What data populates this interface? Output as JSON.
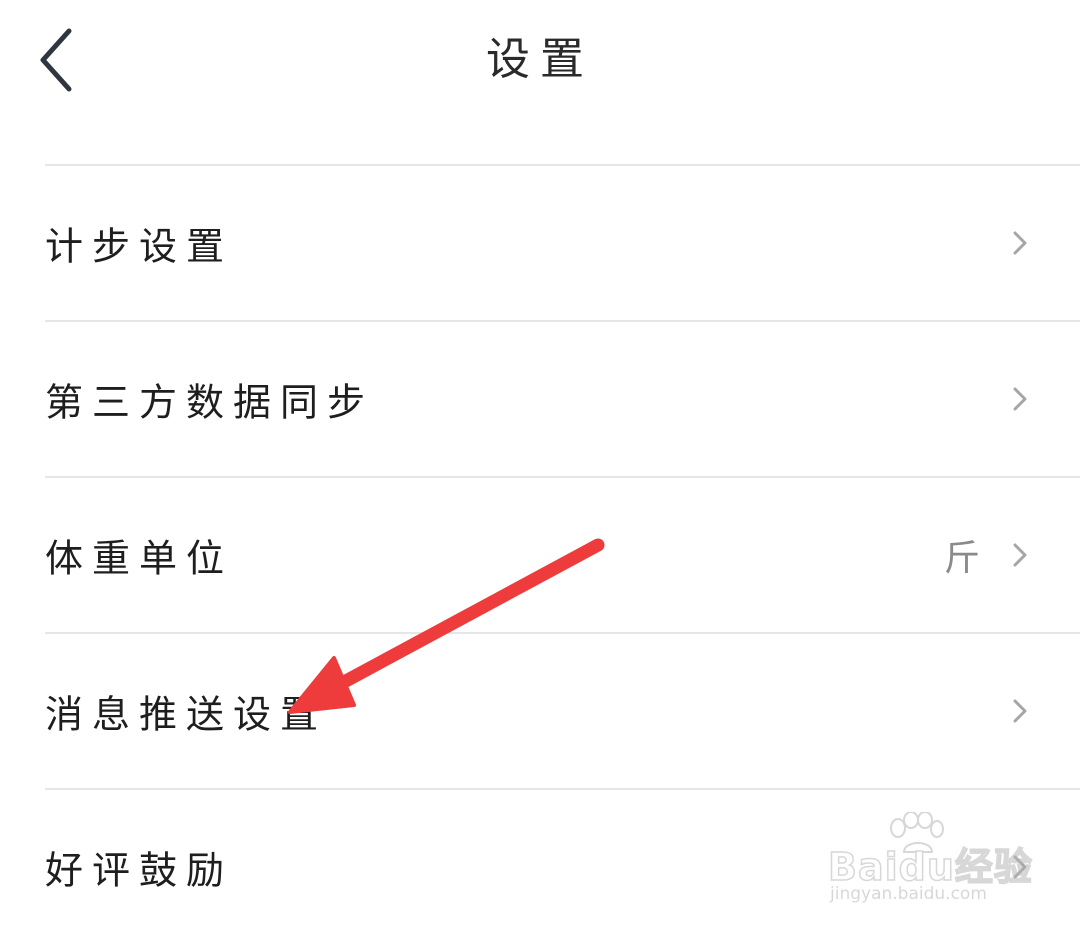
{
  "header": {
    "title": "设置"
  },
  "settings": {
    "items": [
      {
        "label": "计步设置",
        "value": ""
      },
      {
        "label": "第三方数据同步",
        "value": ""
      },
      {
        "label": "体重单位",
        "value": "斤"
      },
      {
        "label": "消息推送设置",
        "value": ""
      },
      {
        "label": "好评鼓励",
        "value": ""
      }
    ]
  },
  "annotation": {
    "arrow_color": "#ee3b3b"
  },
  "watermark": {
    "brand": "Baidu经验",
    "url": "jingyan.baidu.com"
  },
  "icons": {
    "back": "chevron-left-icon",
    "row": "chevron-right-icon",
    "watermark": "paw-icon"
  }
}
